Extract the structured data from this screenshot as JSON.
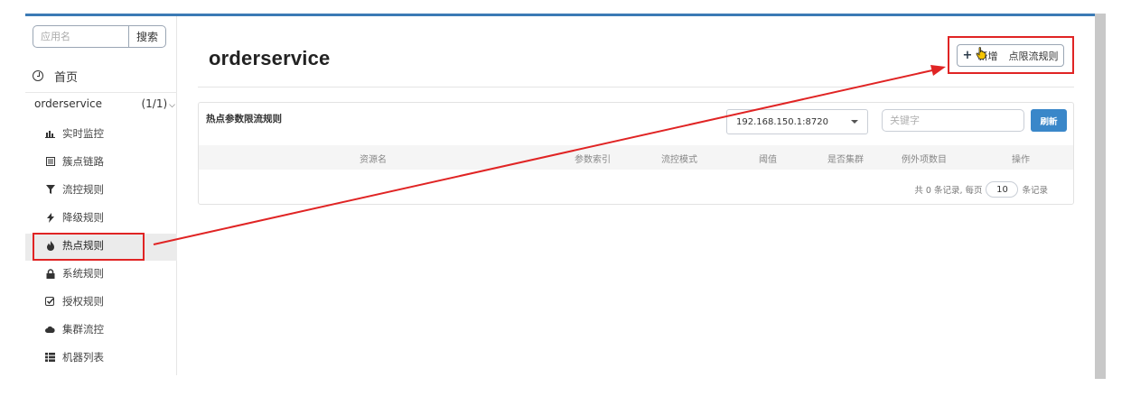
{
  "sidebar": {
    "search": {
      "placeholder": "应用名",
      "button": "搜索"
    },
    "home": "首页",
    "app": {
      "name": "orderservice",
      "count": "(1/1)"
    },
    "items": [
      {
        "label": "实时监控",
        "icon": "bar-chart-icon"
      },
      {
        "label": "簇点链路",
        "icon": "list-box-icon"
      },
      {
        "label": "流控规则",
        "icon": "filter-icon"
      },
      {
        "label": "降级规则",
        "icon": "lightning-icon"
      },
      {
        "label": "热点规则",
        "icon": "fire-icon"
      },
      {
        "label": "系统规则",
        "icon": "lock-icon"
      },
      {
        "label": "授权规则",
        "icon": "check-square-icon"
      },
      {
        "label": "集群流控",
        "icon": "cloud-icon"
      },
      {
        "label": "机器列表",
        "icon": "th-list-icon"
      }
    ],
    "active_index": 4
  },
  "main": {
    "title": "orderservice",
    "add_button": "新增热点限流规则",
    "add_button_visible": "新增",
    "add_button_tail": "点限流规则",
    "panel": {
      "title": "热点参数限流规则",
      "machine": "192.168.150.1:8720",
      "keyword_placeholder": "关键字",
      "refresh": "刷新",
      "columns": [
        "资源名",
        "参数索引",
        "流控模式",
        "阈值",
        "是否集群",
        "例外项数目",
        "操作"
      ],
      "pager": {
        "prefix": "共 0 条记录, 每页",
        "page_size": "10",
        "suffix": "条记录"
      }
    }
  },
  "colors": {
    "accent": "#3a87c9",
    "annotation": "#e02424",
    "topline": "#3b7ab5"
  }
}
